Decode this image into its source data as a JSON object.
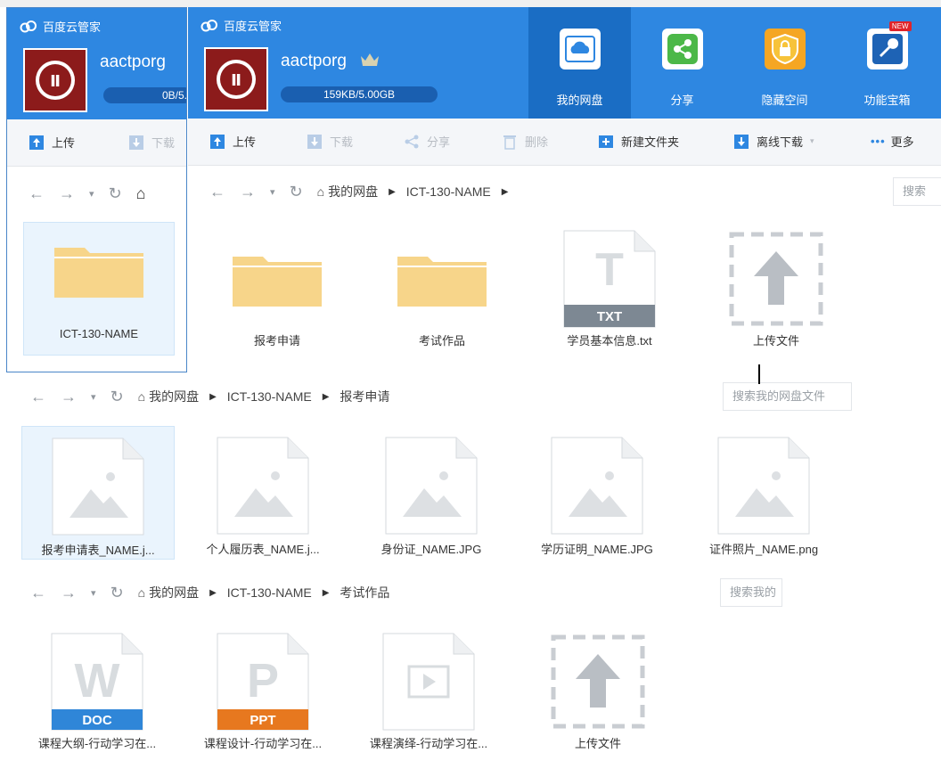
{
  "back_window": {
    "brand": "百度云管家",
    "username": "aactporg",
    "quota": "0B/5.",
    "toolbar": {
      "upload": "上传",
      "download": "下载"
    },
    "folder_name": "ICT-130-NAME"
  },
  "front_window": {
    "brand": "百度云管家",
    "username": "aactporg",
    "quota": "159KB/5.00GB",
    "nav": [
      {
        "label": "我的网盘",
        "icon": "cloud-icon"
      },
      {
        "label": "分享",
        "icon": "share-icon"
      },
      {
        "label": "隐藏空间",
        "icon": "lock-icon"
      },
      {
        "label": "功能宝箱",
        "icon": "toolbox-icon",
        "badge": "NEW"
      }
    ],
    "toolbar": {
      "upload": "上传",
      "download": "下载",
      "share": "分享",
      "delete": "删除",
      "new_folder": "新建文件夹",
      "offline_download": "离线下载",
      "more": "更多"
    },
    "breadcrumb": {
      "root": "我的网盘",
      "folder": "ICT-130-NAME"
    },
    "search_placeholder": "搜索",
    "files": [
      {
        "name": "报考申请",
        "type": "folder"
      },
      {
        "name": "考试作品",
        "type": "folder"
      },
      {
        "name": "学员基本信息.txt",
        "type": "txt",
        "badge": "TXT"
      },
      {
        "name": "上传文件",
        "type": "upload"
      }
    ]
  },
  "panel2": {
    "breadcrumb": {
      "root": "我的网盘",
      "folder": "ICT-130-NAME",
      "sub": "报考申请"
    },
    "search_placeholder": "搜索我的网盘文件",
    "files": [
      {
        "name": "报考申请表_NAME.j..."
      },
      {
        "name": "个人履历表_NAME.j..."
      },
      {
        "name": "身份证_NAME.JPG"
      },
      {
        "name": "学历证明_NAME.JPG"
      },
      {
        "name": "证件照片_NAME.png"
      }
    ]
  },
  "panel3": {
    "breadcrumb": {
      "root": "我的网盘",
      "folder": "ICT-130-NAME",
      "sub": "考试作品"
    },
    "search_placeholder": "搜索我的",
    "files": [
      {
        "name": "课程大纲-行动学习在...",
        "type": "doc",
        "badge": "DOC"
      },
      {
        "name": "课程设计-行动学习在...",
        "type": "ppt",
        "badge": "PPT"
      },
      {
        "name": "课程演绎-行动学习在...",
        "type": "video"
      },
      {
        "name": "上传文件",
        "type": "upload"
      }
    ]
  },
  "colors": {
    "header_blue": "#2e87e1",
    "nav_active": "#1a6dc4",
    "folder": "#f7d58a",
    "doc_blue": "#2f86d8",
    "ppt_orange": "#e7781f",
    "txt_gray": "#7d8893"
  }
}
